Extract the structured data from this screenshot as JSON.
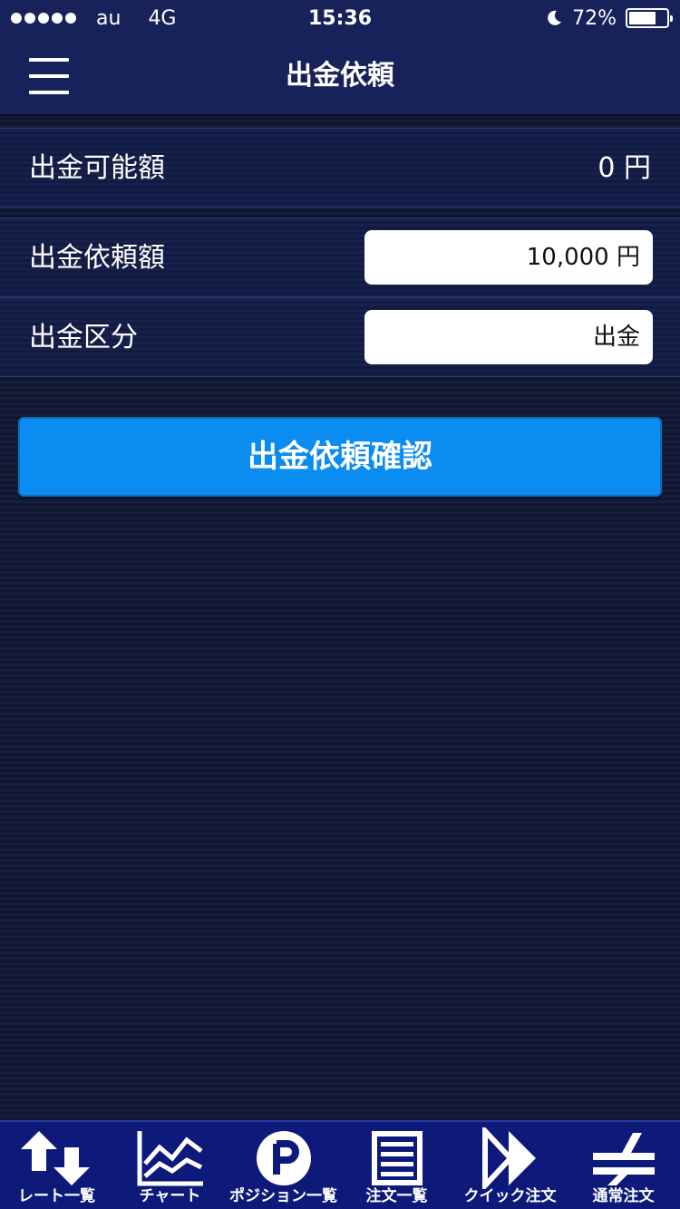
{
  "status_bar": {
    "carrier": "au",
    "network": "4G",
    "time": "15:36",
    "battery": "72%",
    "battery_level": 0.72
  },
  "nav": {
    "title": "出金依頼"
  },
  "available": {
    "label": "出金可能額",
    "value": "0 円"
  },
  "request_amount": {
    "label": "出金依頼額",
    "value": "10,000 円"
  },
  "category": {
    "label": "出金区分",
    "value": "出金"
  },
  "confirm_button": {
    "label": "出金依頼確認"
  },
  "tabs": [
    {
      "label": "レート一覧",
      "icon": "rate-list-icon"
    },
    {
      "label": "チャート",
      "icon": "chart-icon"
    },
    {
      "label": "ポジション一覧",
      "icon": "position-icon"
    },
    {
      "label": "注文一覧",
      "icon": "order-list-icon"
    },
    {
      "label": "クイック注文",
      "icon": "quick-order-icon"
    },
    {
      "label": "通常注文",
      "icon": "normal-order-icon"
    }
  ],
  "colors": {
    "header_bg": "#18225a",
    "button_blue": "#0a8cf0",
    "tabbar_bg": "#0e1a7a"
  }
}
